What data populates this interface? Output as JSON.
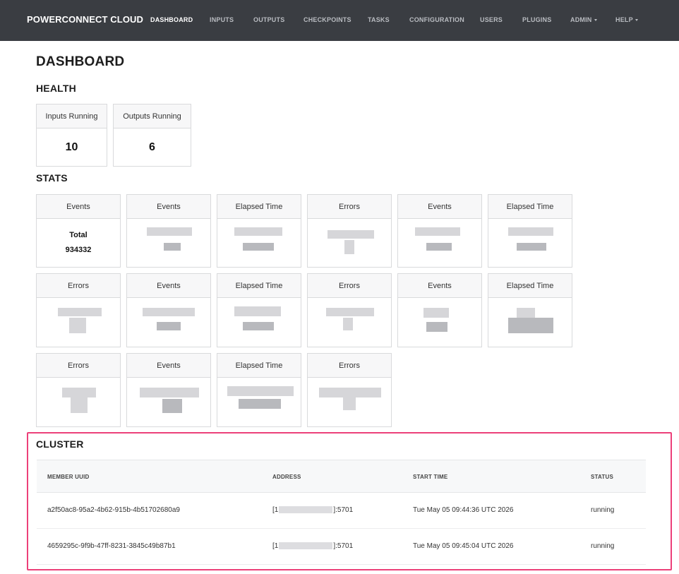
{
  "nav": {
    "brand": "POWERCONNECT CLOUD",
    "items": [
      {
        "label": "DASHBOARD",
        "active": true
      },
      {
        "label": "INPUTS"
      },
      {
        "label": "OUTPUTS"
      },
      {
        "label": "CHECKPOINTS"
      },
      {
        "label": "TASKS"
      },
      {
        "label": "CONFIGURATION"
      },
      {
        "label": "USERS"
      },
      {
        "label": "PLUGINS"
      },
      {
        "label": "ADMIN",
        "dropdown": true
      },
      {
        "label": "HELP",
        "dropdown": true
      }
    ]
  },
  "page": {
    "title": "DASHBOARD"
  },
  "health": {
    "title": "HEALTH",
    "cards": [
      {
        "label": "Inputs Running",
        "value": "10"
      },
      {
        "label": "Outputs Running",
        "value": "6"
      }
    ]
  },
  "stats": {
    "title": "STATS",
    "cards": [
      {
        "label": "Events",
        "total_label": "Total",
        "total_value": "934332"
      },
      {
        "label": "Events"
      },
      {
        "label": "Elapsed Time"
      },
      {
        "label": "Errors"
      },
      {
        "label": "Events"
      },
      {
        "label": "Elapsed Time"
      },
      {
        "label": "Errors"
      },
      {
        "label": "Events"
      },
      {
        "label": "Elapsed Time"
      },
      {
        "label": "Errors"
      },
      {
        "label": "Events"
      },
      {
        "label": "Elapsed Time"
      },
      {
        "label": "Errors"
      },
      {
        "label": "Events"
      },
      {
        "label": "Elapsed Time"
      },
      {
        "label": "Errors"
      }
    ]
  },
  "cluster": {
    "title": "CLUSTER",
    "columns": [
      "MEMBER UUID",
      "ADDRESS",
      "START TIME",
      "STATUS"
    ],
    "rows": [
      {
        "uuid": "a2f50ac8-95a2-4b62-915b-4b51702680a9",
        "addr_prefix": "[1",
        "addr_suffix": "]:5701",
        "start": "Tue May 05 09:44:36 UTC 2026",
        "status": "running"
      },
      {
        "uuid": "4659295c-9f9b-47ff-8231-3845c49b87b1",
        "addr_prefix": "[1",
        "addr_suffix": "]:5701",
        "start": "Tue May 05 09:45:04 UTC 2026",
        "status": "running"
      }
    ]
  },
  "colors": {
    "navbar": "#3a3d42",
    "highlight": "#ec4079"
  }
}
